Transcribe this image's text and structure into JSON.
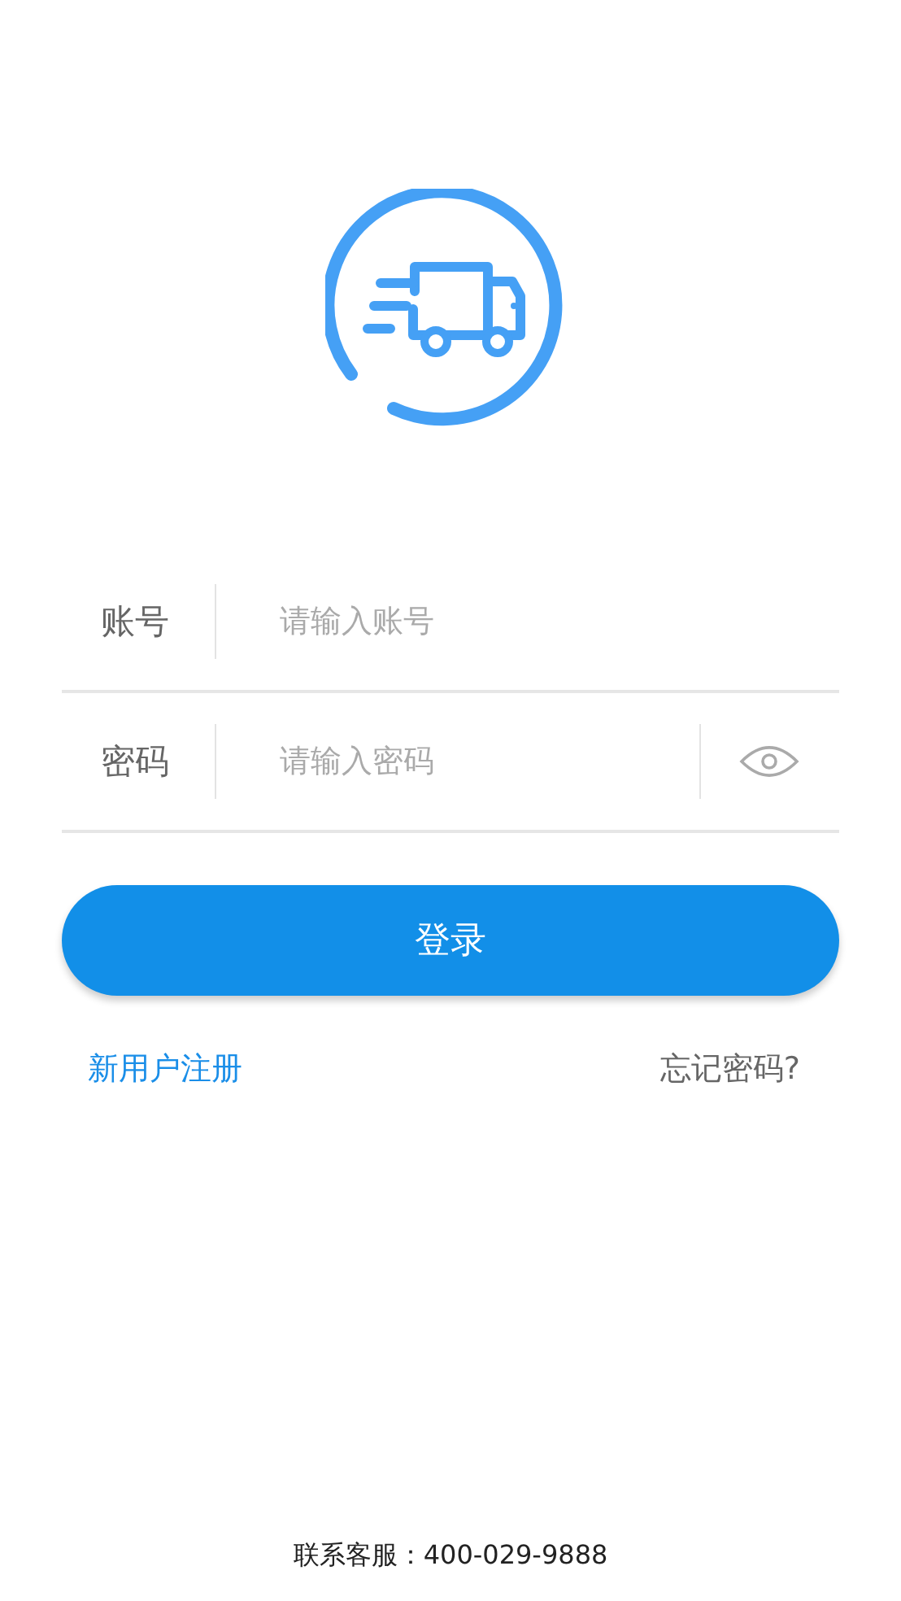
{
  "form": {
    "fields": [
      {
        "kind": "text",
        "label": "账号",
        "placeholder": "请输入账号"
      },
      {
        "kind": "password",
        "label": "密码",
        "placeholder": "请输入密码"
      }
    ]
  },
  "login_button": "登录",
  "register_link": "新用户注册",
  "forgot_link": "忘记密码?",
  "footer": "联系客服：400-029-9888"
}
